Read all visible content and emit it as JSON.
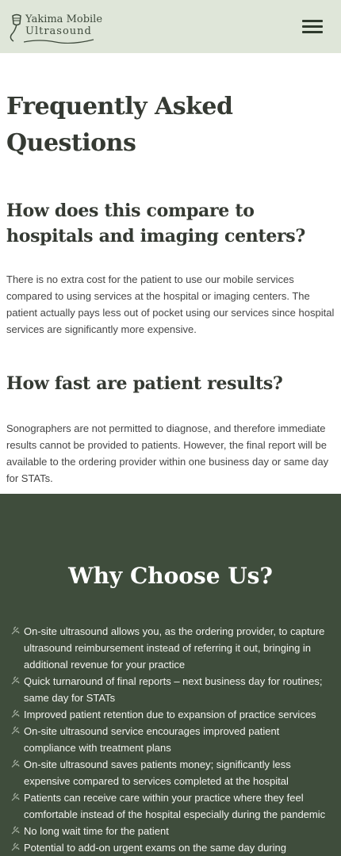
{
  "header": {
    "logo_line1": "Yakima Mobile",
    "logo_line2": "Ultrasound",
    "menu_icon": "hamburger-menu-icon"
  },
  "faq": {
    "title": "Frequently Asked Questions",
    "items": [
      {
        "question": "How does this compare to hospitals and imaging centers?",
        "answer": "There is no extra cost for the patient to use our mobile services compared to using services at the hospital or imaging centers. The patient actually pays less out of pocket using our services since hospital services are significantly more expensive."
      },
      {
        "question": "How fast are patient results?",
        "answer": "Sonographers are not permitted to diagnose, and therefore immediate results cannot be provided to patients. However, the final report will be available to the ordering provider within one business day or same day for STATs."
      }
    ]
  },
  "why": {
    "title": "Why Choose Us?",
    "bullet_icon": "leaf-bullet-icon",
    "items": [
      "On-site ultrasound allows you, as the ordering provider, to capture ultrasound reimbursement instead of referring it out, bringing in additional revenue for your practice",
      "Quick turnaround of final reports – next business day for routines; same day for STATs",
      "Improved patient retention due to expansion of practice services",
      "On-site ultrasound service encourages improved patient compliance with treatment plans",
      "On-site ultrasound saves patients money; significantly less expensive compared to services completed at the hospital",
      "Patients can receive care within your practice where they feel comfortable instead of the hospital especially during the pandemic",
      "No long wait time for the patient",
      "Potential to add-on urgent exams on the same day during"
    ]
  },
  "colors": {
    "header_bg": "#dfe6d9",
    "dark_green": "#3f4d3c",
    "text": "#353a33"
  }
}
